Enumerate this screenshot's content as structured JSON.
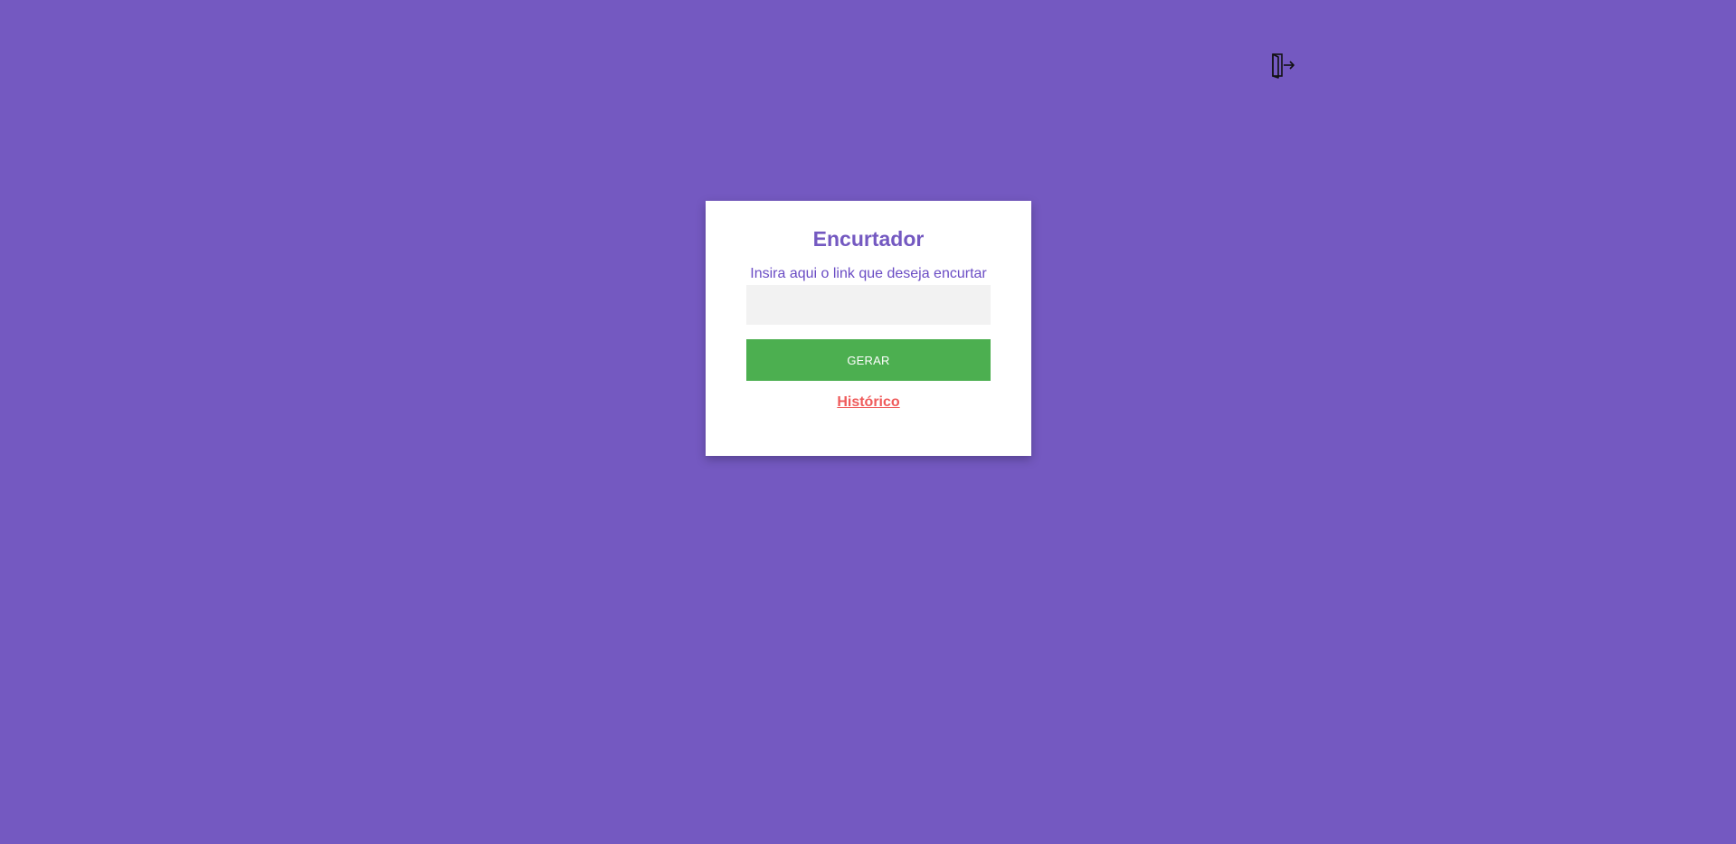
{
  "page": {
    "background_color": "#7459c1"
  },
  "header": {
    "logout_icon": "logout-door-arrow-icon"
  },
  "card": {
    "title": "Encurtador",
    "input_label": "Insira aqui o link que deseja encurtar",
    "input_value": "",
    "input_placeholder": "",
    "generate_button_label": "GERAR",
    "history_link_label": "Histórico",
    "colors": {
      "title": "#7459c1",
      "label": "#6a4cc4",
      "button": "#4caf50",
      "link": "#ef5a5a",
      "input_bg": "#f2f2f2"
    }
  }
}
